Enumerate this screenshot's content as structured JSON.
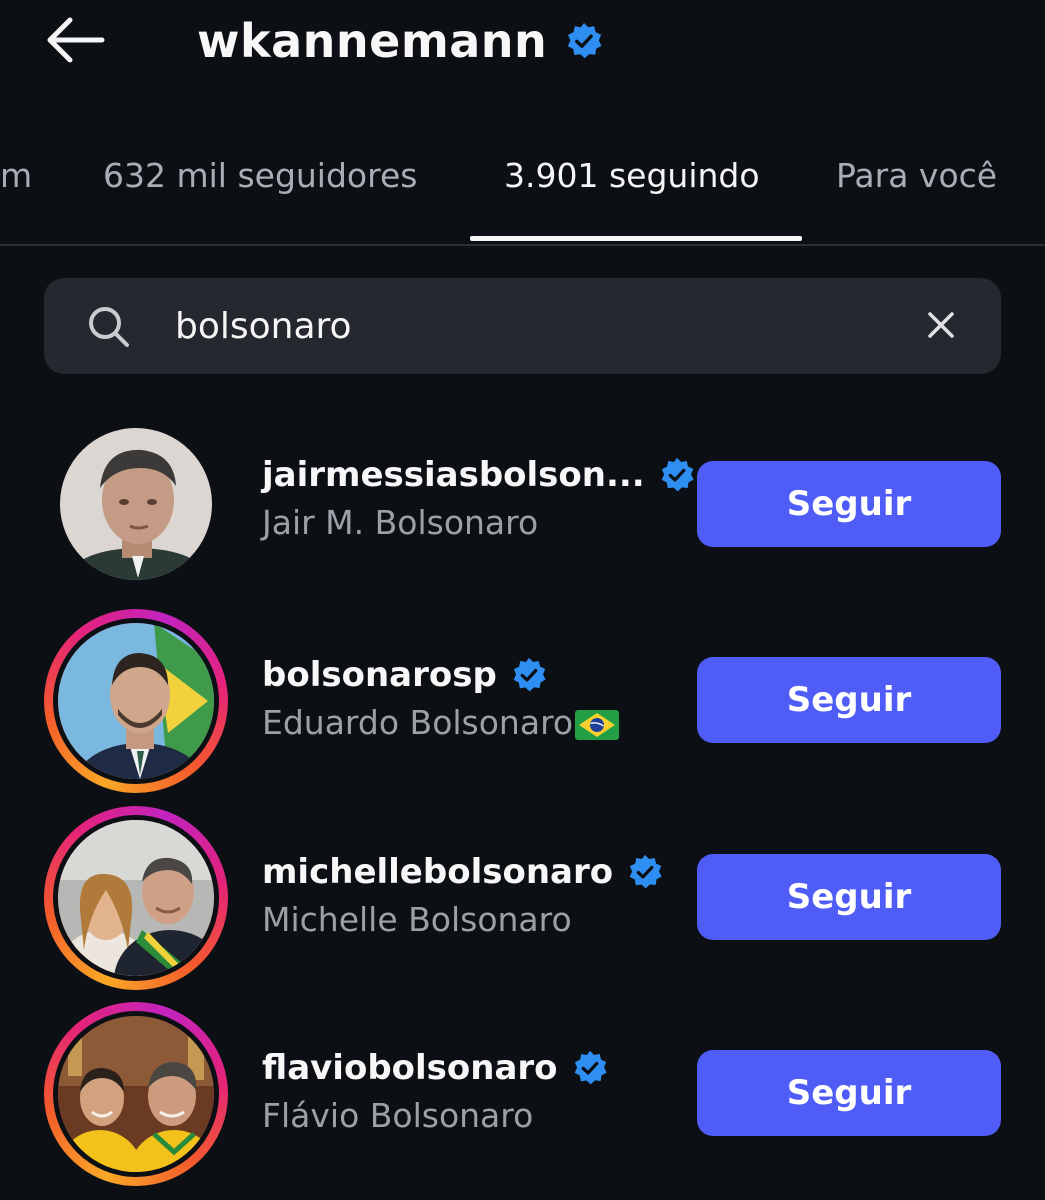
{
  "header": {
    "title": "wkannemann",
    "back_icon": "arrow-left-icon",
    "verified_icon": "verified-badge-icon"
  },
  "tabs": [
    {
      "label": "m"
    },
    {
      "label": "632 mil seguidores"
    },
    {
      "label": "3.901 seguindo",
      "active": true
    },
    {
      "label": "Para você"
    }
  ],
  "search": {
    "value": "bolsonaro",
    "icon": "search-icon",
    "clear_icon": "close-icon"
  },
  "results": [
    {
      "username": "jairmessiasbolson...",
      "name": "Jair M. Bolsonaro",
      "verified": true,
      "has_story": false,
      "button": "Seguir"
    },
    {
      "username": "bolsonarosp",
      "name": "Eduardo Bolsonaro",
      "verified": true,
      "has_story": true,
      "flag_icon": "brazil-flag-icon",
      "button": "Seguir"
    },
    {
      "username": "michellebolsonaro",
      "name": "Michelle Bolsonaro",
      "verified": true,
      "has_story": true,
      "button": "Seguir"
    },
    {
      "username": "flaviobolsonaro",
      "name": "Flávio Bolsonaro",
      "verified": true,
      "has_story": true,
      "button": "Seguir"
    }
  ],
  "colors": {
    "background": "#0c0f14",
    "button": "#4f5cf6",
    "verified": "#2e8ef2",
    "search_bg": "#25292f",
    "muted_text": "#9ca1a8"
  }
}
